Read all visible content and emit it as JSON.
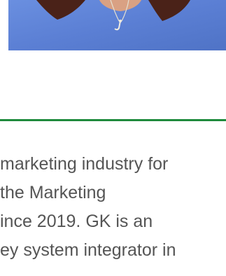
{
  "bio": {
    "lines": [
      "marketing industry for",
      "the Marketing",
      "ince 2019. GK is an",
      "ey system integrator in"
    ]
  }
}
